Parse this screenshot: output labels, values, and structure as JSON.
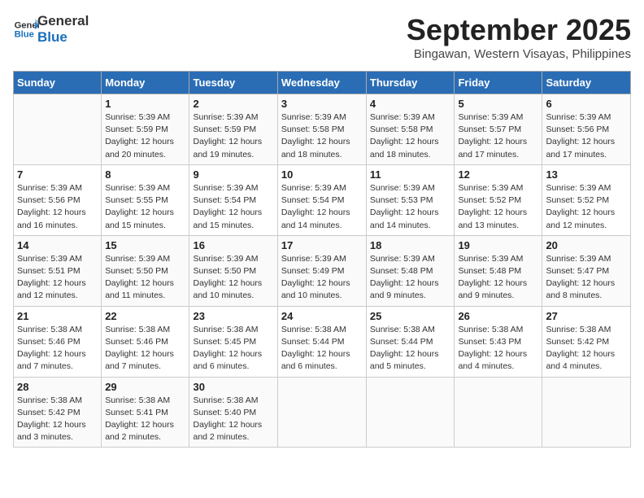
{
  "header": {
    "logo_general": "General",
    "logo_blue": "Blue",
    "month_title": "September 2025",
    "subtitle": "Bingawan, Western Visayas, Philippines"
  },
  "columns": [
    "Sunday",
    "Monday",
    "Tuesday",
    "Wednesday",
    "Thursday",
    "Friday",
    "Saturday"
  ],
  "weeks": [
    [
      {
        "day": "",
        "info": ""
      },
      {
        "day": "1",
        "info": "Sunrise: 5:39 AM\nSunset: 5:59 PM\nDaylight: 12 hours\nand 20 minutes."
      },
      {
        "day": "2",
        "info": "Sunrise: 5:39 AM\nSunset: 5:59 PM\nDaylight: 12 hours\nand 19 minutes."
      },
      {
        "day": "3",
        "info": "Sunrise: 5:39 AM\nSunset: 5:58 PM\nDaylight: 12 hours\nand 18 minutes."
      },
      {
        "day": "4",
        "info": "Sunrise: 5:39 AM\nSunset: 5:58 PM\nDaylight: 12 hours\nand 18 minutes."
      },
      {
        "day": "5",
        "info": "Sunrise: 5:39 AM\nSunset: 5:57 PM\nDaylight: 12 hours\nand 17 minutes."
      },
      {
        "day": "6",
        "info": "Sunrise: 5:39 AM\nSunset: 5:56 PM\nDaylight: 12 hours\nand 17 minutes."
      }
    ],
    [
      {
        "day": "7",
        "info": "Sunrise: 5:39 AM\nSunset: 5:56 PM\nDaylight: 12 hours\nand 16 minutes."
      },
      {
        "day": "8",
        "info": "Sunrise: 5:39 AM\nSunset: 5:55 PM\nDaylight: 12 hours\nand 15 minutes."
      },
      {
        "day": "9",
        "info": "Sunrise: 5:39 AM\nSunset: 5:54 PM\nDaylight: 12 hours\nand 15 minutes."
      },
      {
        "day": "10",
        "info": "Sunrise: 5:39 AM\nSunset: 5:54 PM\nDaylight: 12 hours\nand 14 minutes."
      },
      {
        "day": "11",
        "info": "Sunrise: 5:39 AM\nSunset: 5:53 PM\nDaylight: 12 hours\nand 14 minutes."
      },
      {
        "day": "12",
        "info": "Sunrise: 5:39 AM\nSunset: 5:52 PM\nDaylight: 12 hours\nand 13 minutes."
      },
      {
        "day": "13",
        "info": "Sunrise: 5:39 AM\nSunset: 5:52 PM\nDaylight: 12 hours\nand 12 minutes."
      }
    ],
    [
      {
        "day": "14",
        "info": "Sunrise: 5:39 AM\nSunset: 5:51 PM\nDaylight: 12 hours\nand 12 minutes."
      },
      {
        "day": "15",
        "info": "Sunrise: 5:39 AM\nSunset: 5:50 PM\nDaylight: 12 hours\nand 11 minutes."
      },
      {
        "day": "16",
        "info": "Sunrise: 5:39 AM\nSunset: 5:50 PM\nDaylight: 12 hours\nand 10 minutes."
      },
      {
        "day": "17",
        "info": "Sunrise: 5:39 AM\nSunset: 5:49 PM\nDaylight: 12 hours\nand 10 minutes."
      },
      {
        "day": "18",
        "info": "Sunrise: 5:39 AM\nSunset: 5:48 PM\nDaylight: 12 hours\nand 9 minutes."
      },
      {
        "day": "19",
        "info": "Sunrise: 5:39 AM\nSunset: 5:48 PM\nDaylight: 12 hours\nand 9 minutes."
      },
      {
        "day": "20",
        "info": "Sunrise: 5:39 AM\nSunset: 5:47 PM\nDaylight: 12 hours\nand 8 minutes."
      }
    ],
    [
      {
        "day": "21",
        "info": "Sunrise: 5:38 AM\nSunset: 5:46 PM\nDaylight: 12 hours\nand 7 minutes."
      },
      {
        "day": "22",
        "info": "Sunrise: 5:38 AM\nSunset: 5:46 PM\nDaylight: 12 hours\nand 7 minutes."
      },
      {
        "day": "23",
        "info": "Sunrise: 5:38 AM\nSunset: 5:45 PM\nDaylight: 12 hours\nand 6 minutes."
      },
      {
        "day": "24",
        "info": "Sunrise: 5:38 AM\nSunset: 5:44 PM\nDaylight: 12 hours\nand 6 minutes."
      },
      {
        "day": "25",
        "info": "Sunrise: 5:38 AM\nSunset: 5:44 PM\nDaylight: 12 hours\nand 5 minutes."
      },
      {
        "day": "26",
        "info": "Sunrise: 5:38 AM\nSunset: 5:43 PM\nDaylight: 12 hours\nand 4 minutes."
      },
      {
        "day": "27",
        "info": "Sunrise: 5:38 AM\nSunset: 5:42 PM\nDaylight: 12 hours\nand 4 minutes."
      }
    ],
    [
      {
        "day": "28",
        "info": "Sunrise: 5:38 AM\nSunset: 5:42 PM\nDaylight: 12 hours\nand 3 minutes."
      },
      {
        "day": "29",
        "info": "Sunrise: 5:38 AM\nSunset: 5:41 PM\nDaylight: 12 hours\nand 2 minutes."
      },
      {
        "day": "30",
        "info": "Sunrise: 5:38 AM\nSunset: 5:40 PM\nDaylight: 12 hours\nand 2 minutes."
      },
      {
        "day": "",
        "info": ""
      },
      {
        "day": "",
        "info": ""
      },
      {
        "day": "",
        "info": ""
      },
      {
        "day": "",
        "info": ""
      }
    ]
  ]
}
